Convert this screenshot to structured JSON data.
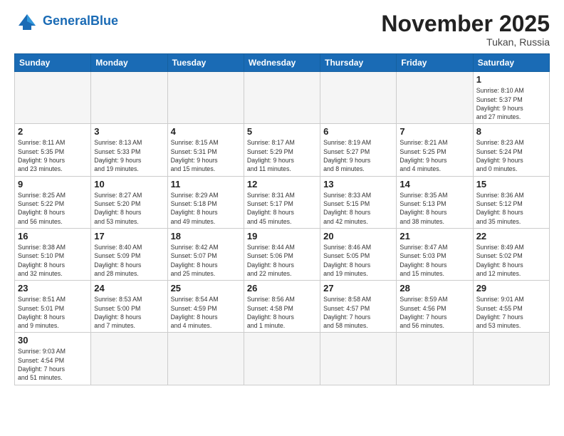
{
  "logo": {
    "general": "General",
    "blue": "Blue"
  },
  "header": {
    "month": "November 2025",
    "location": "Tukan, Russia"
  },
  "weekdays": [
    "Sunday",
    "Monday",
    "Tuesday",
    "Wednesday",
    "Thursday",
    "Friday",
    "Saturday"
  ],
  "weeks": [
    [
      {
        "day": "",
        "info": ""
      },
      {
        "day": "",
        "info": ""
      },
      {
        "day": "",
        "info": ""
      },
      {
        "day": "",
        "info": ""
      },
      {
        "day": "",
        "info": ""
      },
      {
        "day": "",
        "info": ""
      },
      {
        "day": "1",
        "info": "Sunrise: 8:10 AM\nSunset: 5:37 PM\nDaylight: 9 hours\nand 27 minutes."
      }
    ],
    [
      {
        "day": "2",
        "info": "Sunrise: 8:11 AM\nSunset: 5:35 PM\nDaylight: 9 hours\nand 23 minutes."
      },
      {
        "day": "3",
        "info": "Sunrise: 8:13 AM\nSunset: 5:33 PM\nDaylight: 9 hours\nand 19 minutes."
      },
      {
        "day": "4",
        "info": "Sunrise: 8:15 AM\nSunset: 5:31 PM\nDaylight: 9 hours\nand 15 minutes."
      },
      {
        "day": "5",
        "info": "Sunrise: 8:17 AM\nSunset: 5:29 PM\nDaylight: 9 hours\nand 11 minutes."
      },
      {
        "day": "6",
        "info": "Sunrise: 8:19 AM\nSunset: 5:27 PM\nDaylight: 9 hours\nand 8 minutes."
      },
      {
        "day": "7",
        "info": "Sunrise: 8:21 AM\nSunset: 5:25 PM\nDaylight: 9 hours\nand 4 minutes."
      },
      {
        "day": "8",
        "info": "Sunrise: 8:23 AM\nSunset: 5:24 PM\nDaylight: 9 hours\nand 0 minutes."
      }
    ],
    [
      {
        "day": "9",
        "info": "Sunrise: 8:25 AM\nSunset: 5:22 PM\nDaylight: 8 hours\nand 56 minutes."
      },
      {
        "day": "10",
        "info": "Sunrise: 8:27 AM\nSunset: 5:20 PM\nDaylight: 8 hours\nand 53 minutes."
      },
      {
        "day": "11",
        "info": "Sunrise: 8:29 AM\nSunset: 5:18 PM\nDaylight: 8 hours\nand 49 minutes."
      },
      {
        "day": "12",
        "info": "Sunrise: 8:31 AM\nSunset: 5:17 PM\nDaylight: 8 hours\nand 45 minutes."
      },
      {
        "day": "13",
        "info": "Sunrise: 8:33 AM\nSunset: 5:15 PM\nDaylight: 8 hours\nand 42 minutes."
      },
      {
        "day": "14",
        "info": "Sunrise: 8:35 AM\nSunset: 5:13 PM\nDaylight: 8 hours\nand 38 minutes."
      },
      {
        "day": "15",
        "info": "Sunrise: 8:36 AM\nSunset: 5:12 PM\nDaylight: 8 hours\nand 35 minutes."
      }
    ],
    [
      {
        "day": "16",
        "info": "Sunrise: 8:38 AM\nSunset: 5:10 PM\nDaylight: 8 hours\nand 32 minutes."
      },
      {
        "day": "17",
        "info": "Sunrise: 8:40 AM\nSunset: 5:09 PM\nDaylight: 8 hours\nand 28 minutes."
      },
      {
        "day": "18",
        "info": "Sunrise: 8:42 AM\nSunset: 5:07 PM\nDaylight: 8 hours\nand 25 minutes."
      },
      {
        "day": "19",
        "info": "Sunrise: 8:44 AM\nSunset: 5:06 PM\nDaylight: 8 hours\nand 22 minutes."
      },
      {
        "day": "20",
        "info": "Sunrise: 8:46 AM\nSunset: 5:05 PM\nDaylight: 8 hours\nand 19 minutes."
      },
      {
        "day": "21",
        "info": "Sunrise: 8:47 AM\nSunset: 5:03 PM\nDaylight: 8 hours\nand 15 minutes."
      },
      {
        "day": "22",
        "info": "Sunrise: 8:49 AM\nSunset: 5:02 PM\nDaylight: 8 hours\nand 12 minutes."
      }
    ],
    [
      {
        "day": "23",
        "info": "Sunrise: 8:51 AM\nSunset: 5:01 PM\nDaylight: 8 hours\nand 9 minutes."
      },
      {
        "day": "24",
        "info": "Sunrise: 8:53 AM\nSunset: 5:00 PM\nDaylight: 8 hours\nand 7 minutes."
      },
      {
        "day": "25",
        "info": "Sunrise: 8:54 AM\nSunset: 4:59 PM\nDaylight: 8 hours\nand 4 minutes."
      },
      {
        "day": "26",
        "info": "Sunrise: 8:56 AM\nSunset: 4:58 PM\nDaylight: 8 hours\nand 1 minute."
      },
      {
        "day": "27",
        "info": "Sunrise: 8:58 AM\nSunset: 4:57 PM\nDaylight: 7 hours\nand 58 minutes."
      },
      {
        "day": "28",
        "info": "Sunrise: 8:59 AM\nSunset: 4:56 PM\nDaylight: 7 hours\nand 56 minutes."
      },
      {
        "day": "29",
        "info": "Sunrise: 9:01 AM\nSunset: 4:55 PM\nDaylight: 7 hours\nand 53 minutes."
      }
    ],
    [
      {
        "day": "30",
        "info": "Sunrise: 9:03 AM\nSunset: 4:54 PM\nDaylight: 7 hours\nand 51 minutes."
      },
      {
        "day": "",
        "info": ""
      },
      {
        "day": "",
        "info": ""
      },
      {
        "day": "",
        "info": ""
      },
      {
        "day": "",
        "info": ""
      },
      {
        "day": "",
        "info": ""
      },
      {
        "day": "",
        "info": ""
      }
    ]
  ]
}
